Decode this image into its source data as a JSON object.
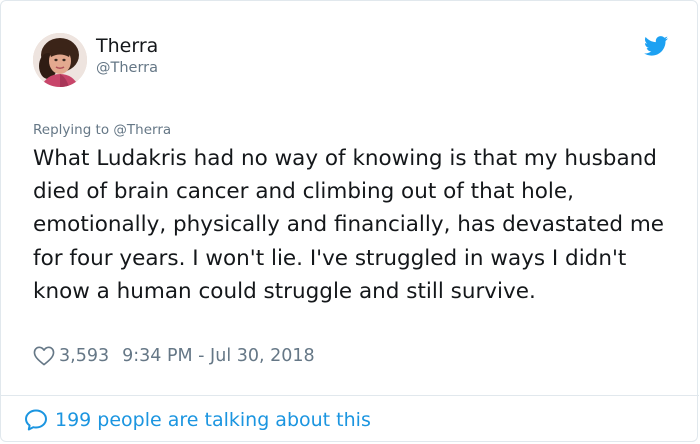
{
  "author": {
    "display_name": "Therra",
    "handle": "@Therra"
  },
  "reply": {
    "text": "Replying to @Therra"
  },
  "tweet": {
    "text": "What Ludakris had no way of knowing is that my husband died of brain cancer and climbing out of that hole, emotionally, physically and financially, has devastated me for four years. I won't lie. I've struggled in ways I didn't know a human could struggle and still survive."
  },
  "meta": {
    "likes": "3,593",
    "timestamp": "9:34 PM - Jul 30, 2018"
  },
  "footer": {
    "conversation_text": "199 people are talking about this"
  },
  "icons": {
    "logo": "twitter-bird-icon",
    "like": "heart-icon",
    "conversation": "speech-bubble-icon"
  },
  "colors": {
    "brand_blue": "#1da1f2",
    "link_blue": "#1b95e0",
    "text_primary": "#14171a",
    "text_secondary": "#657786",
    "border": "#e1e8ed"
  }
}
